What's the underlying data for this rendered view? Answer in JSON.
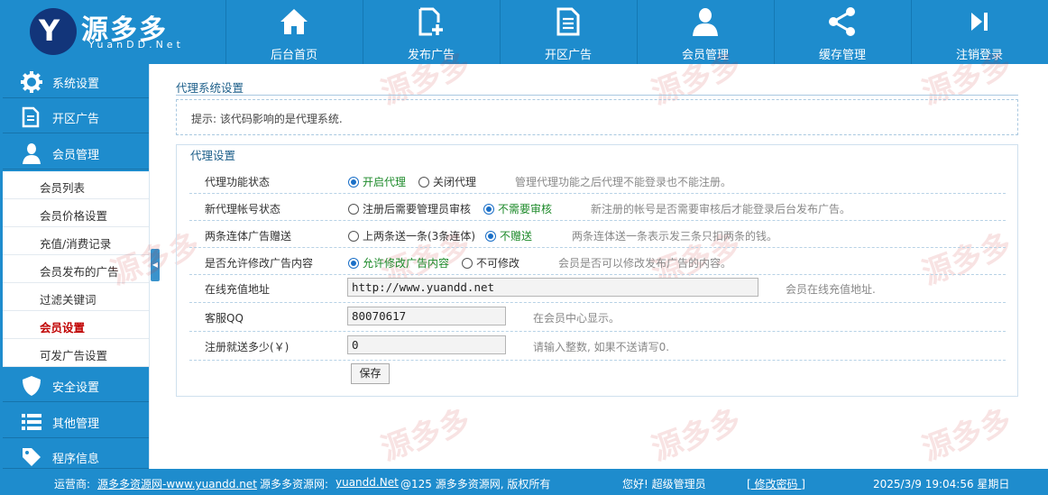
{
  "brand": {
    "name": "源多多",
    "sub": "YuanDD.Net"
  },
  "nav": [
    {
      "label": "后台首页",
      "icon": "home-icon"
    },
    {
      "label": "发布广告",
      "icon": "new-document-icon"
    },
    {
      "label": "开区广告",
      "icon": "document-icon"
    },
    {
      "label": "会员管理",
      "icon": "user-icon"
    },
    {
      "label": "缓存管理",
      "icon": "share-icon"
    },
    {
      "label": "注销登录",
      "icon": "logout-icon"
    }
  ],
  "sidebar": {
    "sections_top": [
      {
        "label": "系统设置",
        "icon": "gear-icon"
      },
      {
        "label": "开区广告",
        "icon": "document-icon"
      },
      {
        "label": "会员管理",
        "icon": "user-icon"
      }
    ],
    "sub_items": [
      {
        "label": "会员列表"
      },
      {
        "label": "会员价格设置"
      },
      {
        "label": "充值/消费记录"
      },
      {
        "label": "会员发布的广告"
      },
      {
        "label": "过滤关键词"
      },
      {
        "label": "会员设置"
      },
      {
        "label": "可发广告设置"
      }
    ],
    "sections_bottom": [
      {
        "label": "安全设置",
        "icon": "shield-icon"
      },
      {
        "label": "其他管理",
        "icon": "list-icon"
      },
      {
        "label": "程序信息",
        "icon": "tag-icon"
      }
    ]
  },
  "page": {
    "title": "代理系统设置",
    "tip": "提示: 该代码影响的是代理系统.",
    "box_title": "代理设置",
    "rows": {
      "r1": {
        "label": "代理功能状态",
        "opt1": "开启代理",
        "opt2": "关闭代理",
        "hint": "管理代理功能之后代理不能登录也不能注册。"
      },
      "r2": {
        "label": "新代理帐号状态",
        "opt1": "注册后需要管理员审核",
        "opt2": "不需要审核",
        "hint": "新注册的帐号是否需要审核后才能登录后台发布广告。"
      },
      "r3": {
        "label": "两条连体广告赠送",
        "opt1": "上两条送一条(3条连体)",
        "opt2": "不赠送",
        "hint": "两条连体送一条表示发三条只扣两条的钱。"
      },
      "r4": {
        "label": "是否允许修改广告内容",
        "opt1": "允许修改广告内容",
        "opt2": "不可修改",
        "hint": "会员是否可以修改发布广告的内容。"
      },
      "r5": {
        "label": "在线充值地址",
        "value": "http://www.yuandd.net",
        "hint": "会员在线充值地址."
      },
      "r6": {
        "label": "客服QQ",
        "value": "80070617",
        "hint": "在会员中心显示。"
      },
      "r7": {
        "label": "注册就送多少(￥)",
        "value": "0",
        "hint": "请输入整数, 如果不送请写0."
      }
    },
    "save_label": "保存"
  },
  "footer": {
    "op_label": "运营商:",
    "op_link": "源多多资源网-www.yuandd.net",
    "site_label": "源多多资源网:",
    "site_link": "yuandd.Net",
    "copyright": "@125 源多多资源网, 版权所有",
    "greeting": "您好!  超级管理员",
    "change_pwd": "[ 修改密码 ]",
    "datetime": "2025/3/9 19:04:56 星期日"
  },
  "watermark": "源多多",
  "colors": {
    "accent": "#1e8ccd",
    "active_text": "#c00000",
    "selected_option": "#1d8a2a"
  }
}
